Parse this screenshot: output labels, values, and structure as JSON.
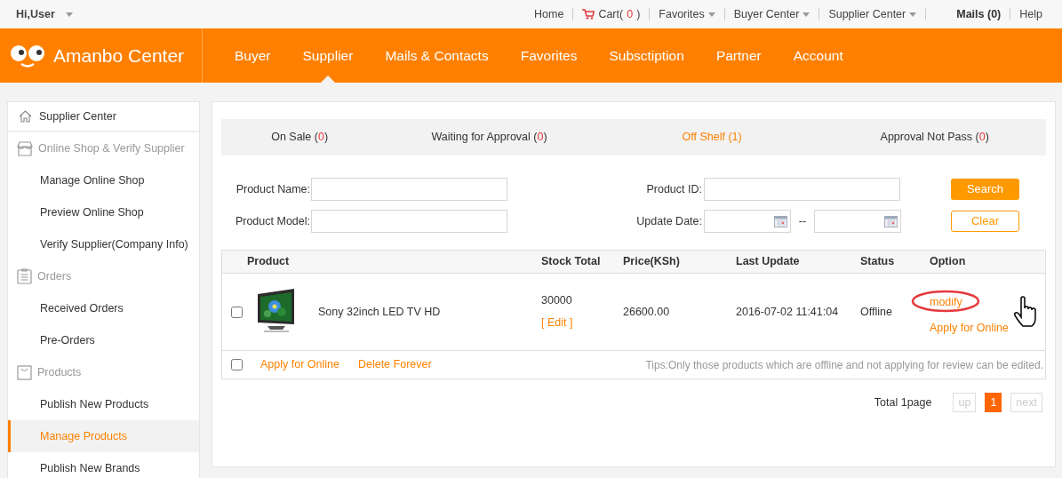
{
  "top_bar": {
    "greeting": "Hi,User",
    "links": [
      {
        "kind": "link",
        "label": "Home"
      },
      {
        "kind": "cart",
        "label": "Cart",
        "open": "(",
        "count": "0",
        "close": ")"
      },
      {
        "kind": "dropdown",
        "label": "Favorites"
      },
      {
        "kind": "dropdown",
        "label": "Buyer Center"
      },
      {
        "kind": "dropdown",
        "label": "Supplier Center"
      },
      {
        "kind": "mails",
        "label": "Mails",
        "open": "(",
        "count": "0",
        "close": ")"
      },
      {
        "kind": "link",
        "label": "Help"
      }
    ]
  },
  "header": {
    "logo": "Amanbo Center",
    "nav": [
      {
        "label": "Buyer",
        "selected": false
      },
      {
        "label": "Supplier",
        "selected": true
      },
      {
        "label": "Mails & Contacts",
        "selected": false
      },
      {
        "label": "Favorites",
        "selected": false
      },
      {
        "label": "Subsctiption",
        "selected": false
      },
      {
        "label": "Partner",
        "selected": false
      },
      {
        "label": "Account",
        "selected": false
      }
    ]
  },
  "sidebar": {
    "title": "Supplier Center",
    "groups": [
      {
        "label": "Online Shop & Verify Supplier",
        "children": [
          {
            "label": "Manage Online Shop",
            "selected": false
          },
          {
            "label": "Preview Online Shop",
            "selected": false
          },
          {
            "label": "Verify Supplier(Company Info)",
            "selected": false
          }
        ]
      },
      {
        "label": "Orders",
        "children": [
          {
            "label": "Received Orders",
            "selected": false
          },
          {
            "label": "Pre-Orders",
            "selected": false
          }
        ]
      },
      {
        "label": "Products",
        "children": [
          {
            "label": "Publish New Products",
            "selected": false
          },
          {
            "label": "Manage Products",
            "selected": true
          },
          {
            "label": "Publish New Brands",
            "selected": false
          }
        ]
      }
    ]
  },
  "tabs": [
    {
      "label": "On Sale",
      "open": "(",
      "count": "0",
      "close": ")",
      "selected": false
    },
    {
      "label": "Waiting for Approval",
      "open": "(",
      "count": "0",
      "close": ")",
      "selected": false
    },
    {
      "label": "Off Shelf",
      "open": "(",
      "count": "1",
      "close": ")",
      "selected": true
    },
    {
      "label": "Approval Not Pass",
      "open": "(",
      "count": "0",
      "close": ")",
      "selected": false
    }
  ],
  "filters": {
    "product_name": "Product Name:",
    "product_id": "Product ID:",
    "product_model": "Product Model:",
    "update_date": "Update Date:",
    "date_separator": "--",
    "search": "Search",
    "clear": "Clear"
  },
  "table": {
    "columns": [
      "Product",
      "Stock Total",
      "Price(KSh)",
      "Last Update",
      "Status",
      "Option"
    ],
    "rows": [
      {
        "checked": false,
        "product": "Sony 32inch LED TV HD",
        "stock": "30000",
        "edit": "[ Edit ]",
        "price": "26600.00",
        "last_update": "2016-07-02 11:41:04",
        "status": "Offline",
        "options": [
          "modify",
          "Apply for Online"
        ]
      }
    ],
    "footer": {
      "checked": false,
      "actions": [
        "Apply for Online",
        "Delete Forever"
      ],
      "tips": "Tips:Only those products which are offline and not applying for review can be edited."
    }
  },
  "pagination": {
    "total": "Total 1page",
    "prev": "up",
    "pages": [
      {
        "label": "1",
        "selected": true
      }
    ],
    "next": "next"
  }
}
